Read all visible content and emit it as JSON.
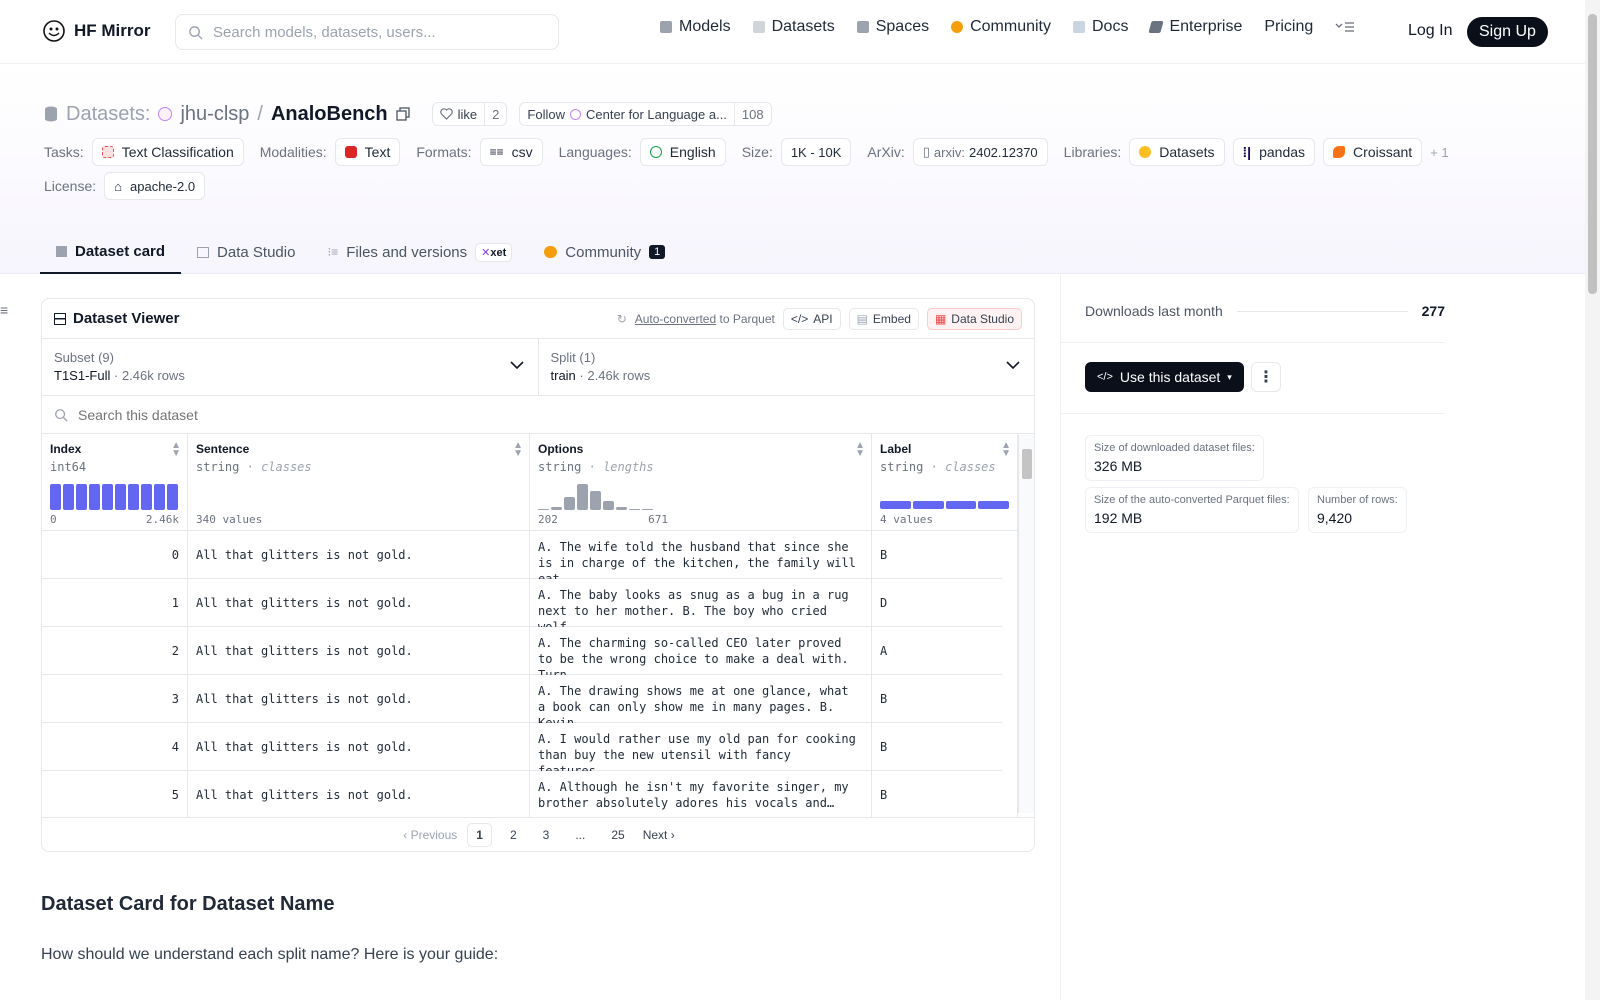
{
  "nav": {
    "brand": "HF Mirror",
    "search_placeholder": "Search models, datasets, users...",
    "links": [
      {
        "label": "Models",
        "icon": "cube-icon",
        "color": "#9ca3af"
      },
      {
        "label": "Datasets",
        "icon": "database-icon",
        "color": "#d1d5db"
      },
      {
        "label": "Spaces",
        "icon": "grid-icon",
        "color": "#9ca3af"
      },
      {
        "label": "Community",
        "icon": "community-icon",
        "color": "#f59e0b"
      },
      {
        "label": "Docs",
        "icon": "book-icon",
        "color": "#9ca3af"
      },
      {
        "label": "Enterprise",
        "icon": "enterprise-icon",
        "color": "#6b7280"
      },
      {
        "label": "Pricing",
        "icon": "",
        "color": ""
      }
    ],
    "login": "Log In",
    "signup": "Sign Up"
  },
  "header": {
    "section": "Datasets:",
    "owner": "jhu-clsp",
    "slash": "/",
    "repo": "AnaloBench",
    "like_label": "like",
    "like_count": "2",
    "follow_label": "Follow",
    "follow_org": "Center for Language a...",
    "follow_count": "108",
    "tags": {
      "tasks_label": "Tasks:",
      "tasks": "Text Classification",
      "modalities_label": "Modalities:",
      "modalities": "Text",
      "formats_label": "Formats:",
      "formats": "csv",
      "languages_label": "Languages:",
      "languages": "English",
      "size_label": "Size:",
      "size": "1K - 10K",
      "arxiv_label": "ArXiv:",
      "arxiv_prefix": "arxiv:",
      "arxiv": "2402.12370",
      "libraries_label": "Libraries:",
      "libs": [
        "Datasets",
        "pandas",
        "Croissant"
      ],
      "libs_more": "+ 1",
      "license_label": "License:",
      "license": "apache-2.0"
    },
    "tabs": [
      {
        "label": "Dataset card",
        "active": true
      },
      {
        "label": "Data Studio",
        "active": false
      },
      {
        "label": "Files and versions",
        "active": false
      },
      {
        "label": "Community",
        "active": false
      }
    ],
    "xet_label": "xet",
    "community_count": "1"
  },
  "viewer": {
    "title": "Dataset Viewer",
    "auto_converted": "Auto-converted",
    "to_parquet": "to Parquet",
    "api": "API",
    "embed": "Embed",
    "data_studio": "Data Studio",
    "subset_label": "Subset (9)",
    "subset_value": "T1S1-Full",
    "subset_rows": "2.46k rows",
    "split_label": "Split (1)",
    "split_value": "train",
    "split_rows": "2.46k rows",
    "search_placeholder": "Search this dataset",
    "columns": [
      {
        "name": "Index",
        "type": "int64",
        "kind": "",
        "foot_left": "0",
        "foot_right": "2.46k"
      },
      {
        "name": "Sentence",
        "type": "string",
        "kind": "classes",
        "foot_left": "340 values",
        "foot_right": ""
      },
      {
        "name": "Options",
        "type": "string",
        "kind": "lengths",
        "foot_left": "202",
        "foot_right": "671"
      },
      {
        "name": "Label",
        "type": "string",
        "kind": "classes",
        "foot_left": "4 values",
        "foot_right": ""
      }
    ],
    "sep": "·",
    "rows": [
      {
        "index": "0",
        "sentence": "All that glitters is not gold.",
        "options": "A. The wife told the husband that since she is in charge of the kitchen, the family will eat…",
        "label": "B"
      },
      {
        "index": "1",
        "sentence": "All that glitters is not gold.",
        "options": "A. The baby looks as snug as a bug in a rug next to her mother. B. The boy who cried wolf…",
        "label": "D"
      },
      {
        "index": "2",
        "sentence": "All that glitters is not gold.",
        "options": "A. The charming so-called CEO later proved to be the wrong choice to make a deal with. Turn…",
        "label": "A"
      },
      {
        "index": "3",
        "sentence": "All that glitters is not gold.",
        "options": "A. The drawing shows me at one glance, what a book can only show me in many pages. B. Kevin…",
        "label": "B"
      },
      {
        "index": "4",
        "sentence": "All that glitters is not gold.",
        "options": "A. I would rather use my old pan for cooking than buy the new utensil with fancy features.…",
        "label": "B"
      },
      {
        "index": "5",
        "sentence": "All that glitters is not gold.",
        "options": "A. Although he isn't my favorite singer, my brother absolutely adores his vocals and…",
        "label": "B"
      }
    ],
    "pager": {
      "prev": "Previous",
      "pages": [
        "1",
        "2",
        "3",
        "...",
        "25"
      ],
      "next": "Next"
    },
    "index_hist": [
      1,
      1,
      1,
      1,
      1,
      1,
      1,
      1,
      1,
      1
    ],
    "options_hist": [
      0.05,
      0.1,
      0.5,
      1,
      0.75,
      0.35,
      0.1,
      0.05,
      0.05
    ]
  },
  "side": {
    "downloads_label": "Downloads last month",
    "downloads": "277",
    "use_button": "Use this dataset",
    "stat1_k": "Size of downloaded dataset files:",
    "stat1_v": "326 MB",
    "stat2_k": "Size of the auto-converted Parquet files:",
    "stat2_v": "192 MB",
    "stat3_k": "Number of rows:",
    "stat3_v": "9,420"
  },
  "card": {
    "heading": "Dataset Card for Dataset Name",
    "para": "How should we understand each split name? Here is your guide:"
  }
}
